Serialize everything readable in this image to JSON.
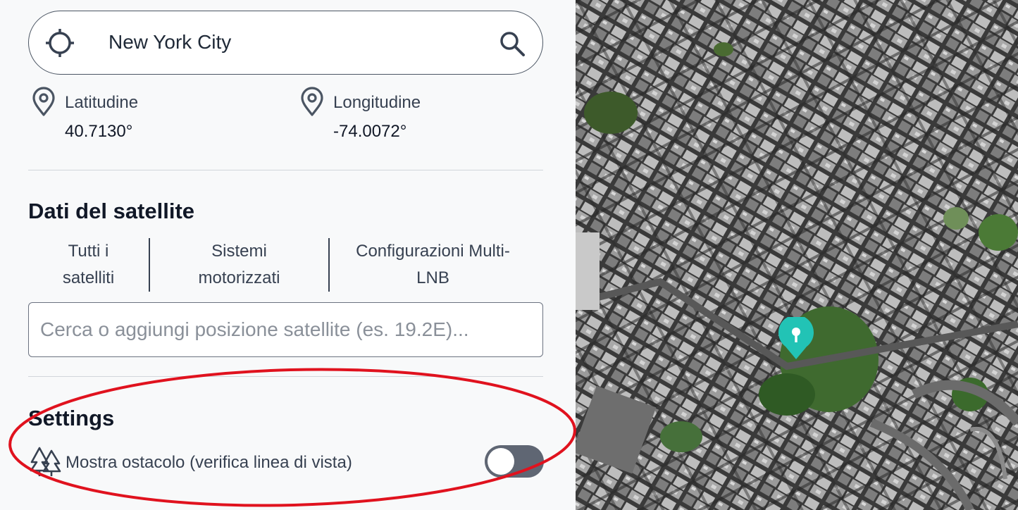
{
  "location_search": {
    "query": "New York City",
    "icons": {
      "locate": "crosshair-icon",
      "search": "search-icon"
    }
  },
  "coordinates": {
    "latitude": {
      "label": "Latitudine",
      "value": "40.7130°",
      "icon": "map-pin-icon"
    },
    "longitude": {
      "label": "Longitudine",
      "value": "-74.0072°",
      "icon": "map-pin-icon"
    }
  },
  "satellite_section": {
    "title": "Dati del satellite",
    "tabs": [
      {
        "line1": "Tutti i",
        "line2": "satelliti"
      },
      {
        "line1": "Sistemi",
        "line2": "motorizzati"
      },
      {
        "line1": "Configurazioni Multi-",
        "line2": "LNB"
      }
    ],
    "search": {
      "value": "",
      "placeholder": "Cerca o aggiungi posizione satellite (es. 19.2E)..."
    }
  },
  "settings_section": {
    "title": "Settings",
    "obstacle_toggle": {
      "label": "Mostra ostacolo (verifica linea di vista)",
      "enabled": false,
      "icon": "trees-icon"
    }
  },
  "map": {
    "view": "satellite",
    "marker_icon": "map-marker-icon",
    "marker_color": "#22c3b5"
  },
  "annotation": {
    "shape": "ellipse",
    "color": "#e0121e"
  }
}
